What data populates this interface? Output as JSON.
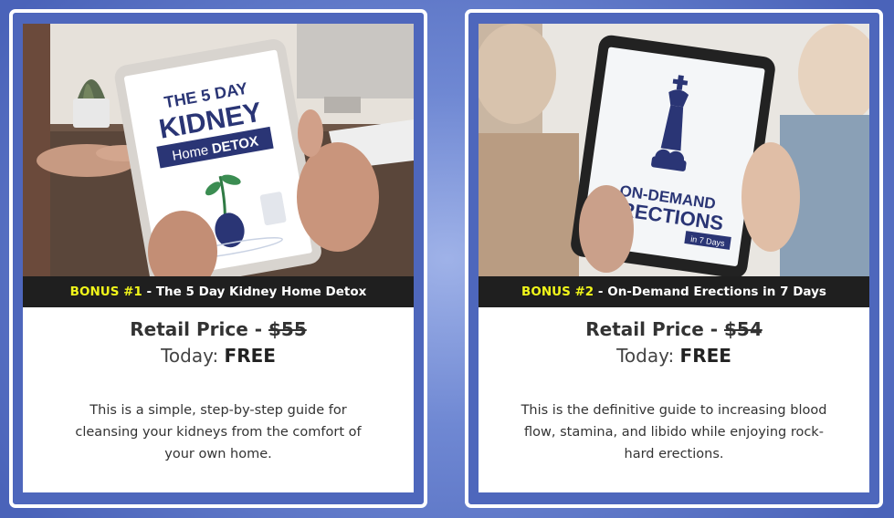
{
  "bonuses": [
    {
      "label": "BONUS #1",
      "sep": " - ",
      "title": "The 5 Day Kidney Home Detox",
      "retail_label": "Retail Price - ",
      "retail_price": "$55",
      "today_label": "Today: ",
      "today_value": "FREE",
      "description": "This is a simple, step-by-step guide for cleansing your kidneys from the comfort of your own home.",
      "cover": {
        "line1": "THE 5 DAY",
        "line2": "KIDNEY",
        "line3a": "Home ",
        "line3b": "DETOX"
      }
    },
    {
      "label": "BONUS #2",
      "sep": " - ",
      "title": "On-Demand Erections in 7 Days",
      "retail_label": "Retail Price - ",
      "retail_price": "$54",
      "today_label": "Today: ",
      "today_value": "FREE",
      "description": "This is the definitive guide to increasing blood flow, stamina, and libido while enjoying rock-hard erections.",
      "cover": {
        "line1": "ON-DEMAND",
        "line2": "ERECTIONS",
        "line3": "in 7 Days"
      }
    }
  ],
  "colors": {
    "background": "#6f88d3",
    "caption_bar": "#1f1f1f",
    "highlight": "#f0f51a",
    "card_border": "#ffffff",
    "cover_navy": "#2a3575"
  }
}
